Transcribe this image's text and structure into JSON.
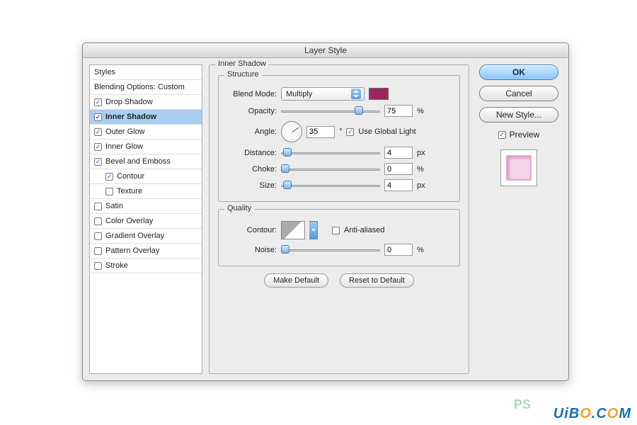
{
  "title": "Layer Style",
  "sidebar": {
    "items": [
      {
        "label": "Styles",
        "checked": null,
        "header": true
      },
      {
        "label": "Blending Options: Custom",
        "checked": null,
        "header": true
      },
      {
        "label": "Drop Shadow",
        "checked": true
      },
      {
        "label": "Inner Shadow",
        "checked": true,
        "selected": true
      },
      {
        "label": "Outer Glow",
        "checked": true
      },
      {
        "label": "Inner Glow",
        "checked": true
      },
      {
        "label": "Bevel and Emboss",
        "checked": true
      },
      {
        "label": "Contour",
        "checked": true,
        "indent": true
      },
      {
        "label": "Texture",
        "checked": false,
        "indent": true
      },
      {
        "label": "Satin",
        "checked": false
      },
      {
        "label": "Color Overlay",
        "checked": false
      },
      {
        "label": "Gradient Overlay",
        "checked": false
      },
      {
        "label": "Pattern Overlay",
        "checked": false
      },
      {
        "label": "Stroke",
        "checked": false
      }
    ]
  },
  "panel": {
    "title": "Inner Shadow",
    "structure": {
      "legend": "Structure",
      "blend_mode_label": "Blend Mode:",
      "blend_mode_value": "Multiply",
      "blend_color": "#99265f",
      "opacity_label": "Opacity:",
      "opacity_value": "75",
      "opacity_unit": "%",
      "angle_label": "Angle:",
      "angle_value": "35",
      "angle_unit": "°",
      "global_light_label": "Use Global Light",
      "global_light_checked": true,
      "distance_label": "Distance:",
      "distance_value": "4",
      "distance_unit": "px",
      "choke_label": "Choke:",
      "choke_value": "0",
      "choke_unit": "%",
      "size_label": "Size:",
      "size_value": "4",
      "size_unit": "px"
    },
    "quality": {
      "legend": "Quality",
      "contour_label": "Contour:",
      "aa_label": "Anti-aliased",
      "aa_checked": false,
      "noise_label": "Noise:",
      "noise_value": "0",
      "noise_unit": "%"
    },
    "make_default": "Make Default",
    "reset_default": "Reset to Default"
  },
  "right": {
    "ok": "OK",
    "cancel": "Cancel",
    "new_style": "New Style...",
    "preview_label": "Preview",
    "preview_checked": true
  },
  "watermark": {
    "text_a": "UiB",
    "text_b": ".C",
    "text_c": "M",
    "ps": "PS"
  }
}
